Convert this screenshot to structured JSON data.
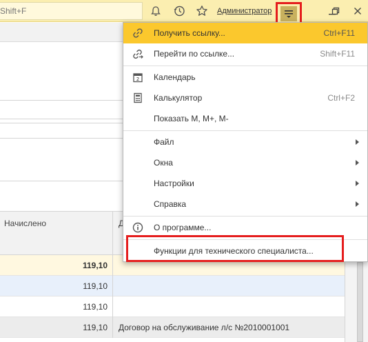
{
  "topbar": {
    "search_placeholder": "Shift+F",
    "user_name": "Администратор"
  },
  "icons": {
    "bell": "bell-icon",
    "history": "history-icon",
    "star": "star-icon",
    "menu": "main-menu-icon",
    "minimize": "minimize-icon",
    "restore": "restore-icon",
    "close": "close-icon"
  },
  "grid": {
    "columns": [
      {
        "label": "Начислено"
      },
      {
        "label": "Д"
      }
    ],
    "rows": [
      {
        "sum": "119,10",
        "doc": "",
        "bold": true
      },
      {
        "sum": "119,10",
        "doc": ""
      },
      {
        "sum": "119,10",
        "doc": ""
      },
      {
        "sum": "119,10",
        "doc": "Договор на обслуживание л/с №2010001001"
      }
    ]
  },
  "menu": {
    "items": [
      {
        "label": "Получить ссылку...",
        "shortcut": "Ctrl+F11",
        "icon": "link-icon",
        "active": true
      },
      {
        "label": "Перейти по ссылке...",
        "shortcut": "Shift+F11",
        "icon": "goto-link-icon"
      },
      {
        "label": "Календарь",
        "shortcut": "",
        "icon": "calendar-icon"
      },
      {
        "label": "Калькулятор",
        "shortcut": "Ctrl+F2",
        "icon": "calculator-icon"
      },
      {
        "label": "Показать М, М+, М-",
        "shortcut": "",
        "icon": ""
      },
      {
        "label": "Файл",
        "shortcut": "",
        "submenu": true
      },
      {
        "label": "Окна",
        "shortcut": "",
        "submenu": true
      },
      {
        "label": "Настройки",
        "shortcut": "",
        "submenu": true
      },
      {
        "label": "Справка",
        "shortcut": "",
        "submenu": true
      },
      {
        "label": "О программе...",
        "shortcut": "",
        "icon": "info-icon"
      },
      {
        "label": "Функции для технического специалиста...",
        "shortcut": ""
      }
    ]
  },
  "colors": {
    "topbar_bg": "#fbeeb0",
    "menu_active": "#fbc82d",
    "annotation_red": "#e51d1d",
    "row_selected": "#e8f0fb"
  }
}
